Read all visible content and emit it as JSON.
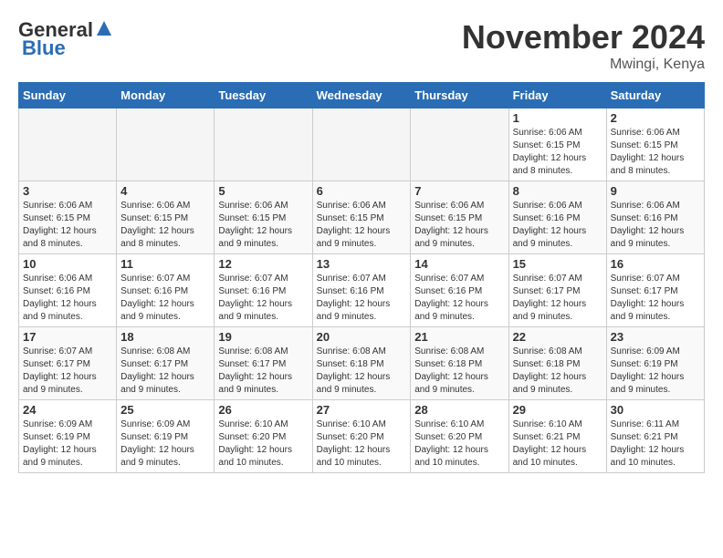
{
  "logo": {
    "general": "General",
    "blue": "Blue"
  },
  "title": "November 2024",
  "location": "Mwingi, Kenya",
  "weekdays": [
    "Sunday",
    "Monday",
    "Tuesday",
    "Wednesday",
    "Thursday",
    "Friday",
    "Saturday"
  ],
  "weeks": [
    [
      {
        "day": "",
        "info": ""
      },
      {
        "day": "",
        "info": ""
      },
      {
        "day": "",
        "info": ""
      },
      {
        "day": "",
        "info": ""
      },
      {
        "day": "",
        "info": ""
      },
      {
        "day": "1",
        "info": "Sunrise: 6:06 AM\nSunset: 6:15 PM\nDaylight: 12 hours and 8 minutes."
      },
      {
        "day": "2",
        "info": "Sunrise: 6:06 AM\nSunset: 6:15 PM\nDaylight: 12 hours and 8 minutes."
      }
    ],
    [
      {
        "day": "3",
        "info": "Sunrise: 6:06 AM\nSunset: 6:15 PM\nDaylight: 12 hours and 8 minutes."
      },
      {
        "day": "4",
        "info": "Sunrise: 6:06 AM\nSunset: 6:15 PM\nDaylight: 12 hours and 8 minutes."
      },
      {
        "day": "5",
        "info": "Sunrise: 6:06 AM\nSunset: 6:15 PM\nDaylight: 12 hours and 9 minutes."
      },
      {
        "day": "6",
        "info": "Sunrise: 6:06 AM\nSunset: 6:15 PM\nDaylight: 12 hours and 9 minutes."
      },
      {
        "day": "7",
        "info": "Sunrise: 6:06 AM\nSunset: 6:15 PM\nDaylight: 12 hours and 9 minutes."
      },
      {
        "day": "8",
        "info": "Sunrise: 6:06 AM\nSunset: 6:16 PM\nDaylight: 12 hours and 9 minutes."
      },
      {
        "day": "9",
        "info": "Sunrise: 6:06 AM\nSunset: 6:16 PM\nDaylight: 12 hours and 9 minutes."
      }
    ],
    [
      {
        "day": "10",
        "info": "Sunrise: 6:06 AM\nSunset: 6:16 PM\nDaylight: 12 hours and 9 minutes."
      },
      {
        "day": "11",
        "info": "Sunrise: 6:07 AM\nSunset: 6:16 PM\nDaylight: 12 hours and 9 minutes."
      },
      {
        "day": "12",
        "info": "Sunrise: 6:07 AM\nSunset: 6:16 PM\nDaylight: 12 hours and 9 minutes."
      },
      {
        "day": "13",
        "info": "Sunrise: 6:07 AM\nSunset: 6:16 PM\nDaylight: 12 hours and 9 minutes."
      },
      {
        "day": "14",
        "info": "Sunrise: 6:07 AM\nSunset: 6:16 PM\nDaylight: 12 hours and 9 minutes."
      },
      {
        "day": "15",
        "info": "Sunrise: 6:07 AM\nSunset: 6:17 PM\nDaylight: 12 hours and 9 minutes."
      },
      {
        "day": "16",
        "info": "Sunrise: 6:07 AM\nSunset: 6:17 PM\nDaylight: 12 hours and 9 minutes."
      }
    ],
    [
      {
        "day": "17",
        "info": "Sunrise: 6:07 AM\nSunset: 6:17 PM\nDaylight: 12 hours and 9 minutes."
      },
      {
        "day": "18",
        "info": "Sunrise: 6:08 AM\nSunset: 6:17 PM\nDaylight: 12 hours and 9 minutes."
      },
      {
        "day": "19",
        "info": "Sunrise: 6:08 AM\nSunset: 6:17 PM\nDaylight: 12 hours and 9 minutes."
      },
      {
        "day": "20",
        "info": "Sunrise: 6:08 AM\nSunset: 6:18 PM\nDaylight: 12 hours and 9 minutes."
      },
      {
        "day": "21",
        "info": "Sunrise: 6:08 AM\nSunset: 6:18 PM\nDaylight: 12 hours and 9 minutes."
      },
      {
        "day": "22",
        "info": "Sunrise: 6:08 AM\nSunset: 6:18 PM\nDaylight: 12 hours and 9 minutes."
      },
      {
        "day": "23",
        "info": "Sunrise: 6:09 AM\nSunset: 6:19 PM\nDaylight: 12 hours and 9 minutes."
      }
    ],
    [
      {
        "day": "24",
        "info": "Sunrise: 6:09 AM\nSunset: 6:19 PM\nDaylight: 12 hours and 9 minutes."
      },
      {
        "day": "25",
        "info": "Sunrise: 6:09 AM\nSunset: 6:19 PM\nDaylight: 12 hours and 9 minutes."
      },
      {
        "day": "26",
        "info": "Sunrise: 6:10 AM\nSunset: 6:20 PM\nDaylight: 12 hours and 10 minutes."
      },
      {
        "day": "27",
        "info": "Sunrise: 6:10 AM\nSunset: 6:20 PM\nDaylight: 12 hours and 10 minutes."
      },
      {
        "day": "28",
        "info": "Sunrise: 6:10 AM\nSunset: 6:20 PM\nDaylight: 12 hours and 10 minutes."
      },
      {
        "day": "29",
        "info": "Sunrise: 6:10 AM\nSunset: 6:21 PM\nDaylight: 12 hours and 10 minutes."
      },
      {
        "day": "30",
        "info": "Sunrise: 6:11 AM\nSunset: 6:21 PM\nDaylight: 12 hours and 10 minutes."
      }
    ]
  ]
}
